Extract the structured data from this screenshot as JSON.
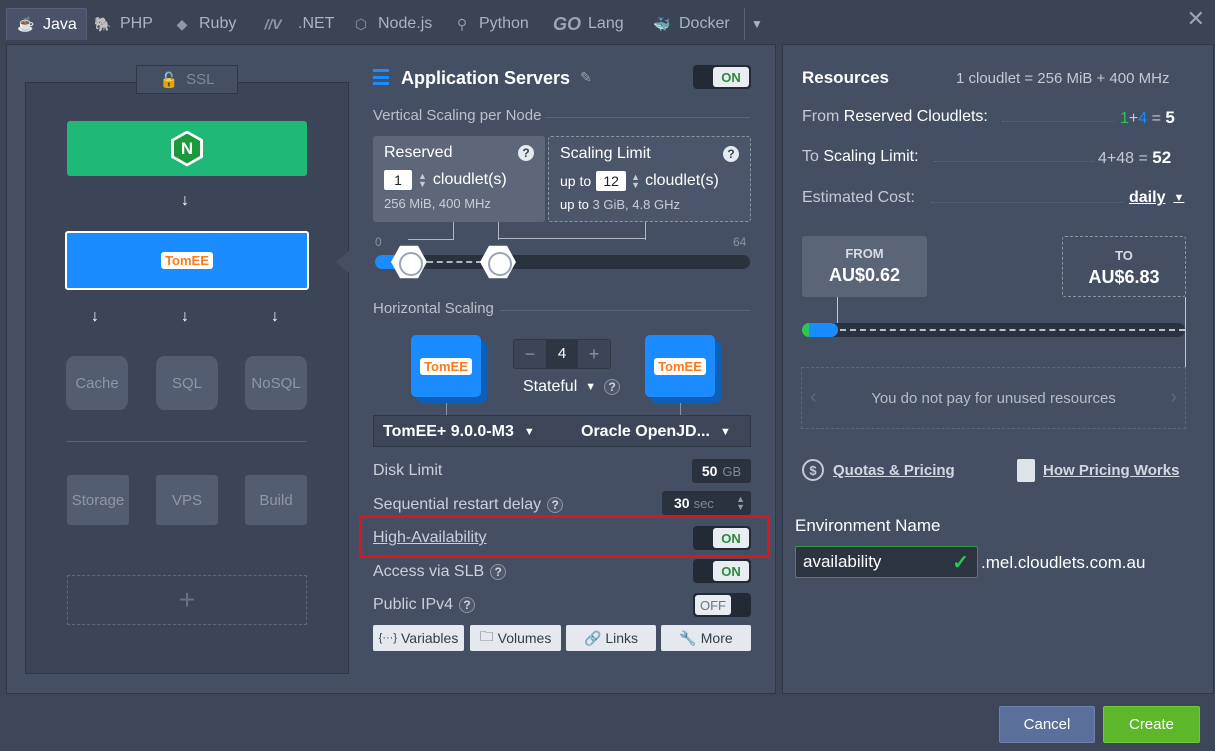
{
  "tabs": [
    {
      "label": "Java",
      "icon": "java-icon",
      "active": true
    },
    {
      "label": "PHP",
      "icon": "php-elephant-icon"
    },
    {
      "label": "Ruby",
      "icon": "ruby-icon"
    },
    {
      "label": ".NET",
      "icon": "dotnet-icon"
    },
    {
      "label": "Node.js",
      "icon": "nodejs-icon"
    },
    {
      "label": "Python",
      "icon": "python-icon"
    },
    {
      "label": "Lang",
      "icon": "go-icon",
      "prefix": "GO"
    },
    {
      "label": "Docker",
      "icon": "docker-icon"
    }
  ],
  "topology": {
    "ssl_label": "SSL",
    "cache": "Cache",
    "sql": "SQL",
    "nosql": "NoSQL",
    "storage": "Storage",
    "vps": "VPS",
    "build": "Build",
    "add": "+",
    "balancer_letter": "N",
    "tomee_logo": "TomEE"
  },
  "config": {
    "title": "Application Servers",
    "title_toggle": "ON",
    "vertical_label": "Vertical Scaling per Node",
    "reserved": {
      "title": "Reserved",
      "value": "1",
      "unit": "cloudlet(s)",
      "detail": "256 MiB, 400 MHz"
    },
    "scaling_limit": {
      "title": "Scaling Limit",
      "prefix": "up to",
      "value": "12",
      "unit": "cloudlet(s)",
      "detail_prefix": "up to",
      "detail": "3 GiB, 4.8 GHz"
    },
    "slider_min": "0",
    "slider_max": "64",
    "horizontal_label": "Horizontal Scaling",
    "node_count": "4",
    "stateful": "Stateful",
    "server_version": "TomEE+ 9.0.0-M3",
    "jdk": "Oracle OpenJD...",
    "disk_limit_label": "Disk Limit",
    "disk_value": "50",
    "disk_unit": "GB",
    "restart_label": "Sequential restart delay",
    "restart_value": "30",
    "restart_unit": "sec",
    "ha_label": "High-Availability",
    "ha_toggle": "ON",
    "slb_label": "Access via SLB",
    "slb_toggle": "ON",
    "ipv4_label": "Public IPv4",
    "ipv4_toggle": "OFF",
    "buttons": {
      "variables": "Variables",
      "volumes": "Volumes",
      "links": "Links",
      "more": "More"
    }
  },
  "resources": {
    "title": "Resources",
    "cloudlet_def": "1 cloudlet = 256 MiB + 400 MHz",
    "reserved_label_a": "From",
    "reserved_label_b": "Reserved Cloudlets:",
    "reserved_a": "1",
    "plus": "+",
    "reserved_b": "4",
    "equals": "=",
    "reserved_total": "5",
    "limit_label_a": "To",
    "limit_label_b": "Scaling Limit:",
    "limit_calc": "4+48",
    "limit_total": "52",
    "cost_label": "Estimated Cost:",
    "cost_period": "daily",
    "from_label": "FROM",
    "from_price": "AU$0.62",
    "to_label": "TO",
    "to_price": "AU$6.83",
    "unused_text": "You do not pay for unused resources",
    "quotas_link": "Quotas & Pricing",
    "how_link": "How Pricing Works",
    "env_label": "Environment Name",
    "env_value": "availability",
    "env_domain": ".mel.cloudlets.com.au"
  },
  "footer": {
    "cancel": "Cancel",
    "create": "Create"
  },
  "colors": {
    "accent_green": "#2e9b3f",
    "accent_blue": "#1a8cff",
    "highlight_red": "#e0141b",
    "create_green": "#5cb82a",
    "cancel_blue": "#5a6f9a"
  }
}
